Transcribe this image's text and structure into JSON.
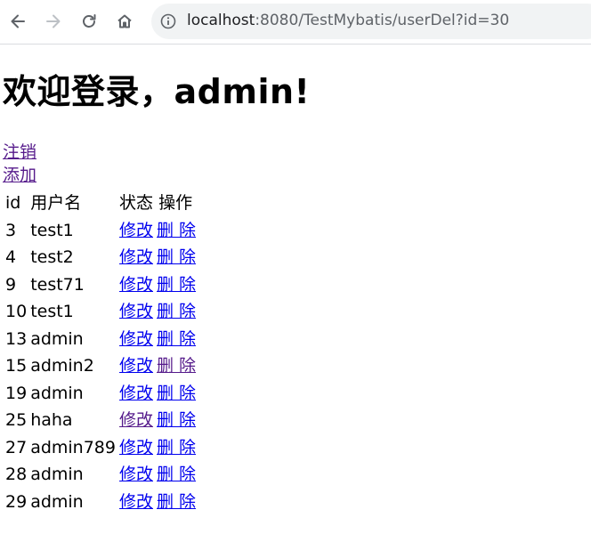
{
  "browser": {
    "url_host": "localhost",
    "url_rest": ":8080/TestMybatis/userDel?id=30"
  },
  "page": {
    "heading": "欢迎登录，admin!",
    "logout_label": "注销",
    "add_label": "添加"
  },
  "table": {
    "headers": {
      "id": "id",
      "username": "用户名",
      "status": "状态",
      "action": "操作"
    },
    "edit_label": "修改",
    "delete_label": "删 除",
    "rows": [
      {
        "id": "3",
        "username": "test1",
        "edit_visited": false,
        "delete_visited": false
      },
      {
        "id": "4",
        "username": "test2",
        "edit_visited": false,
        "delete_visited": false
      },
      {
        "id": "9",
        "username": "test71",
        "edit_visited": false,
        "delete_visited": false
      },
      {
        "id": "10",
        "username": "test1",
        "edit_visited": false,
        "delete_visited": false
      },
      {
        "id": "13",
        "username": "admin",
        "edit_visited": false,
        "delete_visited": false
      },
      {
        "id": "15",
        "username": "admin2",
        "edit_visited": false,
        "delete_visited": true
      },
      {
        "id": "19",
        "username": "admin",
        "edit_visited": false,
        "delete_visited": false
      },
      {
        "id": "25",
        "username": "haha",
        "edit_visited": true,
        "delete_visited": false
      },
      {
        "id": "27",
        "username": "admin789",
        "edit_visited": false,
        "delete_visited": false
      },
      {
        "id": "28",
        "username": "admin",
        "edit_visited": false,
        "delete_visited": false
      },
      {
        "id": "29",
        "username": "admin",
        "edit_visited": false,
        "delete_visited": false
      }
    ]
  },
  "colors": {
    "link": "#0000ee",
    "visited_link": "#551a8b",
    "omnibox_bg": "#f1f3f4"
  }
}
